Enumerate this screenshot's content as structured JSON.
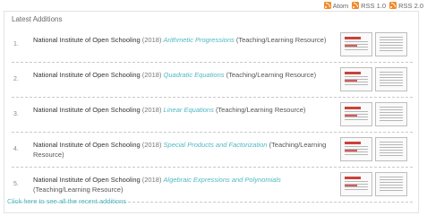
{
  "feeds": [
    {
      "label": "Atom",
      "icon": "rss-icon"
    },
    {
      "label": "RSS 1.0",
      "icon": "rss-icon"
    },
    {
      "label": "RSS 2.0",
      "icon": "rss-icon"
    }
  ],
  "panel": {
    "heading": "Latest Additions",
    "items": [
      {
        "num": "1.",
        "author": "National Institute of Open Schooling",
        "year": "(2018)",
        "title": "Arithmetic Progressions",
        "type": "(Teaching/Learning Resource)"
      },
      {
        "num": "2.",
        "author": "National Institute of Open Schooling",
        "year": "(2018)",
        "title": "Quadratic Equations",
        "type": "(Teaching/Learning Resource)"
      },
      {
        "num": "3.",
        "author": "National Institute of Open Schooling",
        "year": "(2018)",
        "title": "Linear Equations",
        "type": "(Teaching/Learning Resource)"
      },
      {
        "num": "4.",
        "author": "National Institute of Open Schooling",
        "year": "(2018)",
        "title": "Special Products and Factorization",
        "type": "(Teaching/Learning Resource)"
      },
      {
        "num": "5.",
        "author": "National Institute of Open Schooling",
        "year": "(2018)",
        "title": "Algebraic Expressions and Polynomials",
        "type": "(Teaching/Learning Resource)"
      }
    ],
    "footer_link": "Click here to see all the recent additions"
  },
  "colors": {
    "accent_link": "#4fb8c2",
    "rss": "#f28a28"
  }
}
